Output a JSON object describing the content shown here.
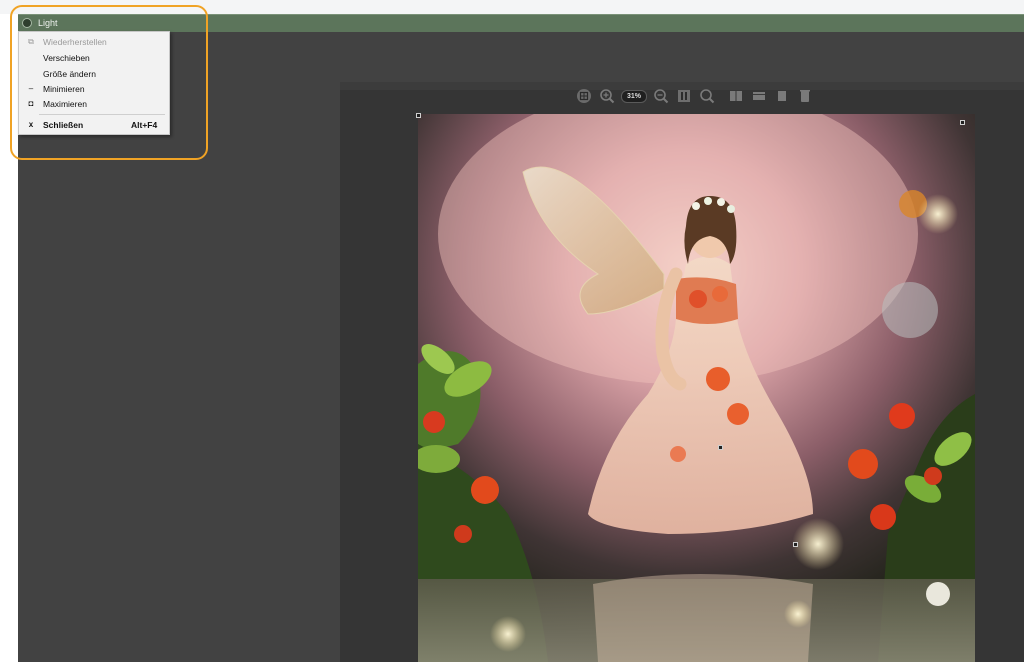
{
  "window": {
    "title": "Light"
  },
  "system_menu": {
    "items": [
      {
        "icon": "restore-icon",
        "glyph": "⧉",
        "label": "Wiederherstellen",
        "shortcut": "",
        "enabled": false,
        "bold": false
      },
      {
        "icon": "",
        "glyph": "",
        "label": "Verschieben",
        "shortcut": "",
        "enabled": true,
        "bold": false
      },
      {
        "icon": "",
        "glyph": "",
        "label": "Größe ändern",
        "shortcut": "",
        "enabled": true,
        "bold": false
      },
      {
        "icon": "minimize-icon",
        "glyph": "–",
        "label": "Minimieren",
        "shortcut": "",
        "enabled": true,
        "bold": false
      },
      {
        "icon": "maximize-icon",
        "glyph": "◘",
        "label": "Maximieren",
        "shortcut": "",
        "enabled": true,
        "bold": false
      },
      {
        "icon": "close-icon",
        "glyph": "x",
        "label": "Schließen",
        "shortcut": "Alt+F4",
        "enabled": true,
        "bold": true
      }
    ]
  },
  "viewer_toolbar": {
    "zoom_level": "31%",
    "buttons": [
      "fit-to-window-icon",
      "zoom-in-icon",
      "zoom-out-icon",
      "actual-size-icon",
      "loupe-icon",
      "compare-icon",
      "filmstrip-icon",
      "single-view-icon",
      "trash-icon"
    ]
  },
  "colors": {
    "titlebar": "#5c755b",
    "app_background": "#424242",
    "canvas_background": "#353535",
    "highlight": "#f0a325"
  }
}
